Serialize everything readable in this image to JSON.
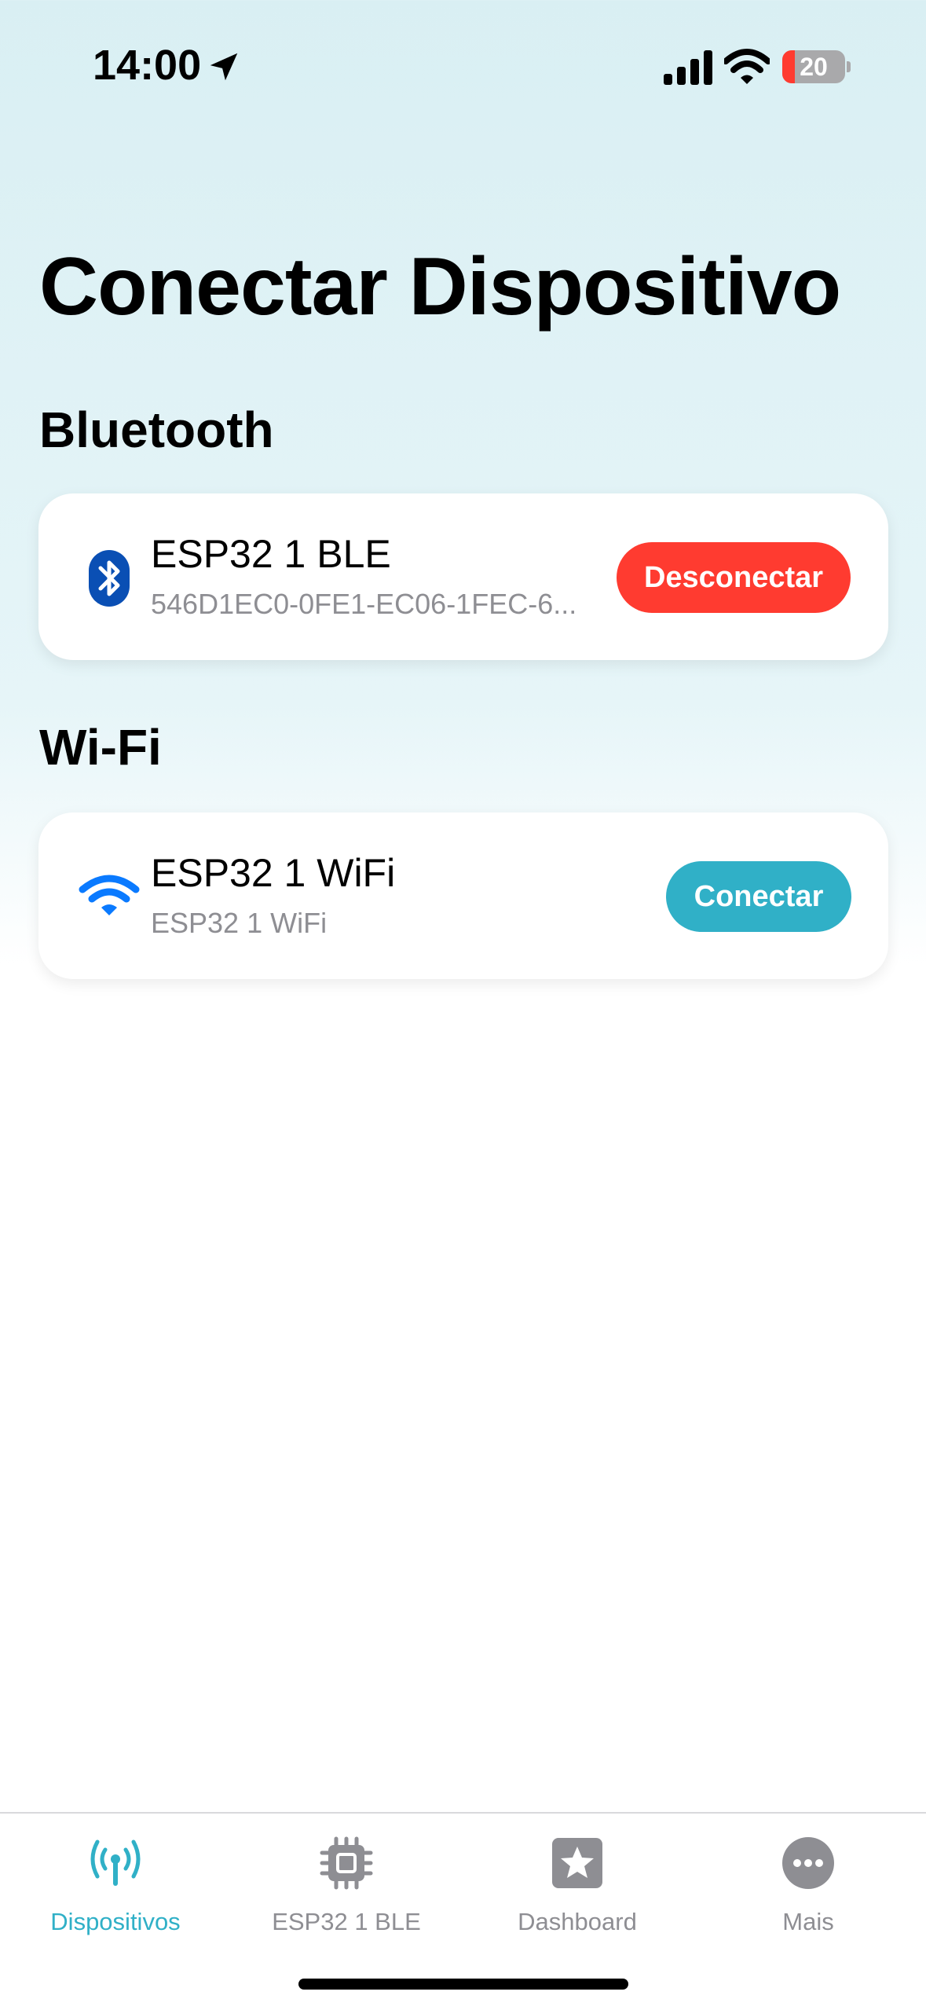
{
  "status_bar": {
    "time": "14:00",
    "battery_level": "20",
    "battery_fraction": 0.2,
    "icons": [
      "location-arrow-icon",
      "cellular-signal-icon",
      "wifi-icon",
      "battery-icon"
    ]
  },
  "page": {
    "title": "Conectar Dispositivo"
  },
  "sections": {
    "bluetooth": {
      "title": "Bluetooth",
      "device": {
        "icon": "bluetooth-icon",
        "name": "ESP32 1 BLE",
        "identifier": "546D1EC0-0FE1-EC06-1FEC-6...",
        "action_label": "Desconectar"
      }
    },
    "wifi": {
      "title": "Wi-Fi",
      "device": {
        "icon": "wifi-icon",
        "name": "ESP32 1 WiFi",
        "identifier": "ESP32 1 WiFi",
        "action_label": "Conectar"
      }
    }
  },
  "tab_bar": {
    "tabs": [
      {
        "label": "Dispositivos",
        "icon": "antenna-icon",
        "active": true
      },
      {
        "label": "ESP32 1 BLE",
        "icon": "chip-icon",
        "active": false
      },
      {
        "label": "Dashboard",
        "icon": "star-square-icon",
        "active": false
      },
      {
        "label": "Mais",
        "icon": "more-ellipsis-icon",
        "active": false
      }
    ]
  },
  "colors": {
    "accent": "#30b0c7",
    "danger": "#ff3b30",
    "bluetooth_blue": "#0a4fb4",
    "wifi_blue": "#0a7aff",
    "inactive_gray": "#8e8e93"
  }
}
